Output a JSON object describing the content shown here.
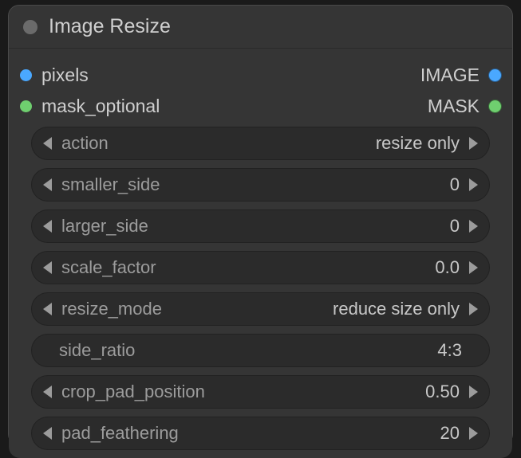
{
  "node": {
    "title": "Image Resize",
    "inputs": [
      {
        "label": "pixels",
        "color": "blue"
      },
      {
        "label": "mask_optional",
        "color": "green"
      }
    ],
    "outputs": [
      {
        "label": "IMAGE",
        "color": "blue"
      },
      {
        "label": "MASK",
        "color": "green"
      }
    ],
    "widgets": {
      "action": {
        "label": "action",
        "value": "resize only"
      },
      "smaller_side": {
        "label": "smaller_side",
        "value": "0"
      },
      "larger_side": {
        "label": "larger_side",
        "value": "0"
      },
      "scale_factor": {
        "label": "scale_factor",
        "value": "0.0"
      },
      "resize_mode": {
        "label": "resize_mode",
        "value": "reduce size only"
      },
      "side_ratio": {
        "label": "side_ratio",
        "value": "4:3"
      },
      "crop_pad_position": {
        "label": "crop_pad_position",
        "value": "0.50"
      },
      "pad_feathering": {
        "label": "pad_feathering",
        "value": "20"
      }
    }
  }
}
